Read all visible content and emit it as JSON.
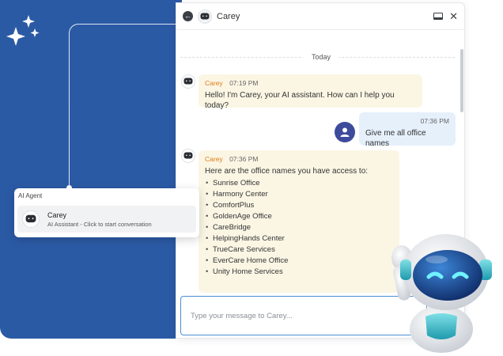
{
  "chat": {
    "title": "Carey",
    "day_separator": "Today",
    "composer_placeholder": "Type your message to Carey...",
    "messages": [
      {
        "sender": "Carey",
        "time": "07:19 PM",
        "text": "Hello! I'm Carey, your AI assistant. How can I help you today?"
      },
      {
        "sender": "user",
        "time": "07:36 PM",
        "text": "Give me all office names"
      },
      {
        "sender": "Carey",
        "time": "07:36 PM",
        "intro": "Here are the office names you have access to:",
        "offices": [
          "Sunrise Office",
          "Harmony Center",
          "ComfortPlus",
          "GoldenAge Office",
          "CareBridge",
          "HelpingHands Center",
          "TrueCare Services",
          "EverCare Home Office",
          "Unity Home Services"
        ]
      }
    ]
  },
  "agent_card": {
    "section_title": "AI Agent",
    "name": "Carey",
    "subtitle": "AI Assistant - Click to start conversation"
  },
  "colors": {
    "brand_blue": "#2b5aa5",
    "bot_bubble": "#fbf6e4",
    "user_bubble": "#e6f0fb",
    "sender_name": "#e07b17",
    "user_avatar": "#3e4b9c",
    "composer_border": "#4a8fd6"
  },
  "icons": {
    "back": "back-arrow-icon",
    "bot": "chat-bot-icon",
    "minimize": "minimize-icon",
    "close": "close-icon",
    "user": "user-icon",
    "sparkle": "sparkle-icon"
  }
}
